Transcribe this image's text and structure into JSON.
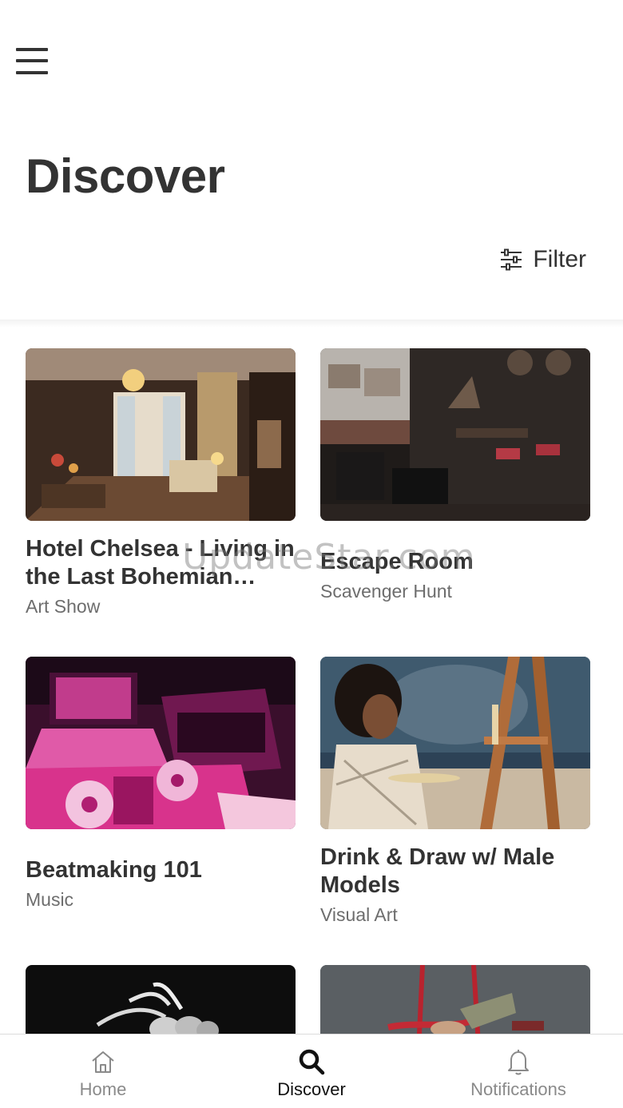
{
  "header": {
    "menu_icon": "hamburger-icon",
    "title": "Discover",
    "filter_label": "Filter",
    "filter_icon": "sliders-icon"
  },
  "cards": [
    {
      "title": "Hotel Chelsea - Living in the Last Bohemian…",
      "category": "Art Show",
      "image": "hotel-lobby-photo"
    },
    {
      "title": "Escape Room",
      "category": "Scavenger Hunt",
      "image": "dark-lounge-photo"
    },
    {
      "title": "Beatmaking 101",
      "category": "Music",
      "image": "dj-controller-photo"
    },
    {
      "title": "Drink & Draw w/ Male Models",
      "category": "Visual Art",
      "image": "painter-easel-photo"
    },
    {
      "image": "dancers-photo"
    },
    {
      "image": "aerial-silks-photo"
    }
  ],
  "watermark": "UpdateStar.com",
  "bottom_nav": {
    "items": [
      {
        "label": "Home",
        "icon": "home-icon",
        "active": false
      },
      {
        "label": "Discover",
        "icon": "search-icon",
        "active": true
      },
      {
        "label": "Notifications",
        "icon": "bell-icon",
        "active": false
      }
    ]
  },
  "colors": {
    "text_primary": "#333333",
    "text_secondary": "#6d6d6d",
    "nav_inactive": "#8a8a8a",
    "nav_active": "#111111"
  }
}
